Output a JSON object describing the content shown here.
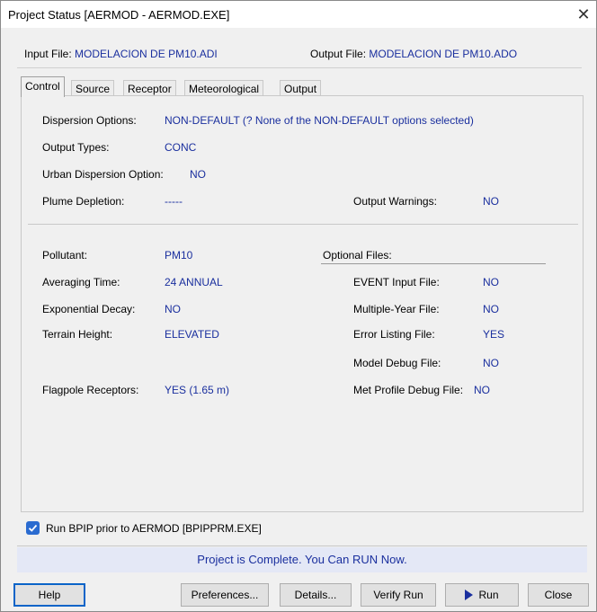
{
  "window": {
    "title": "Project Status [AERMOD - AERMOD.EXE]",
    "close_glyph": "✕"
  },
  "files": {
    "input_label": "Input File:",
    "input_value": "MODELACION DE PM10.ADI",
    "output_label": "Output File:",
    "output_value": "MODELACION DE PM10.ADO"
  },
  "tabs": [
    "Control",
    "Source",
    "Receptor",
    "Meteorological",
    "Output"
  ],
  "active_tab": "Control",
  "control": {
    "dispersion_label": "Dispersion Options:",
    "dispersion_value": "NON-DEFAULT (? None of the NON-DEFAULT options selected)",
    "output_types_label": "Output Types:",
    "output_types_value": "CONC",
    "urban_label": "Urban Dispersion Option:",
    "urban_value": "NO",
    "plume_label": "Plume Depletion:",
    "plume_value": "-----",
    "warnings_label": "Output Warnings:",
    "warnings_value": "NO",
    "pollutant_label": "Pollutant:",
    "pollutant_value": "PM10",
    "averaging_label": "Averaging Time:",
    "averaging_value": "24 ANNUAL",
    "decay_label": "Exponential Decay:",
    "decay_value": "NO",
    "terrain_label": "Terrain Height:",
    "terrain_value": "ELEVATED",
    "flagpole_label": "Flagpole Receptors:",
    "flagpole_value": "YES (1.65 m)",
    "optional_files_heading": "Optional Files:",
    "event_label": "EVENT Input File:",
    "event_value": "NO",
    "multiyear_label": "Multiple-Year File:",
    "multiyear_value": "NO",
    "errorlist_label": "Error Listing File:",
    "errorlist_value": "YES",
    "modeldebug_label": "Model Debug File:",
    "modeldebug_value": "NO",
    "metprofile_label": "Met Profile Debug File:",
    "metprofile_value": "NO"
  },
  "bpip": {
    "checked": true,
    "label": "Run BPIP prior to AERMOD [BPIPPRM.EXE]"
  },
  "status_message": "Project is Complete.  You Can RUN Now.",
  "buttons": {
    "help": "Help",
    "preferences": "Preferences...",
    "details": "Details...",
    "verify_run": "Verify Run",
    "run": "Run",
    "close": "Close"
  },
  "colors": {
    "value_blue": "#1a2f9e",
    "checkbox_blue": "#2a6bd0",
    "status_bg": "#e4e8f6"
  }
}
